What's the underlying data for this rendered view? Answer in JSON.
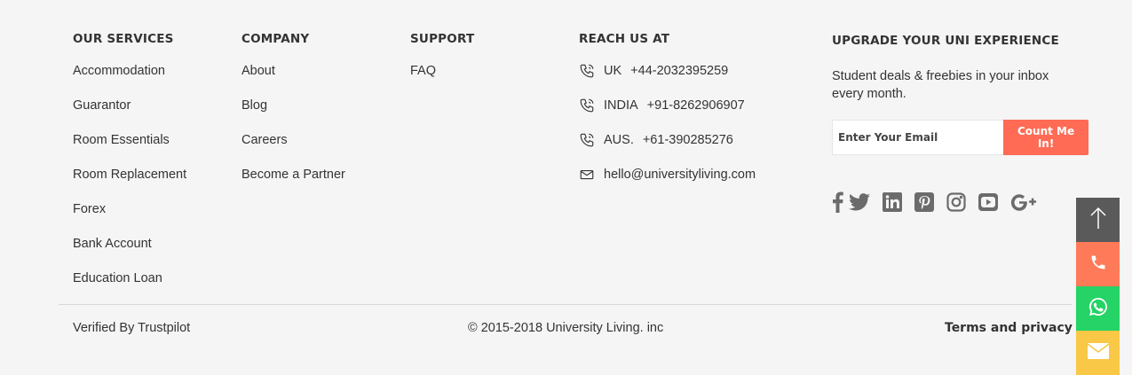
{
  "services": {
    "heading": "OUR SERVICES",
    "items": [
      "Accommodation",
      "Guarantor",
      "Room Essentials",
      "Room Replacement",
      "Forex",
      "Bank Account",
      "Education Loan"
    ]
  },
  "company": {
    "heading": "COMPANY",
    "items": [
      "About",
      "Blog",
      "Careers",
      "Become a Partner"
    ]
  },
  "support": {
    "heading": "SUPPORT",
    "items": [
      "FAQ"
    ]
  },
  "reach": {
    "heading": "REACH US AT",
    "phones": [
      {
        "country": "UK",
        "number": "+44-2032395259"
      },
      {
        "country": "INDIA",
        "number": "+91-8262906907"
      },
      {
        "country": "AUS.",
        "number": "+61-390285276"
      }
    ],
    "email": "hello@universityliving.com"
  },
  "upgrade": {
    "heading": "UPGRADE YOUR UNI EXPERIENCE",
    "text": "Student deals & freebies in your inbox every month.",
    "email_placeholder": "Enter Your Email",
    "button_label": "Count Me In!"
  },
  "social_icons": [
    "facebook-icon",
    "twitter-icon",
    "linkedin-icon",
    "pinterest-icon",
    "instagram-icon",
    "youtube-icon",
    "google-plus-icon"
  ],
  "bottom": {
    "trustpilot": "Verified By Trustpilot",
    "copyright": "© 2015-2018 University Living. inc",
    "terms": "Terms and privacy"
  },
  "floating": {
    "items": [
      "scroll-top-icon",
      "phone-icon",
      "whatsapp-icon",
      "mail-icon"
    ],
    "colors": {
      "scroll_top": "#5a5a5a",
      "phone": "#ff7a59",
      "whatsapp": "#25d366",
      "mail": "#f9c846"
    }
  },
  "colors": {
    "accent": "#ff6b55",
    "background": "#f4f5f4",
    "icon_gray": "#6b6b6b"
  }
}
